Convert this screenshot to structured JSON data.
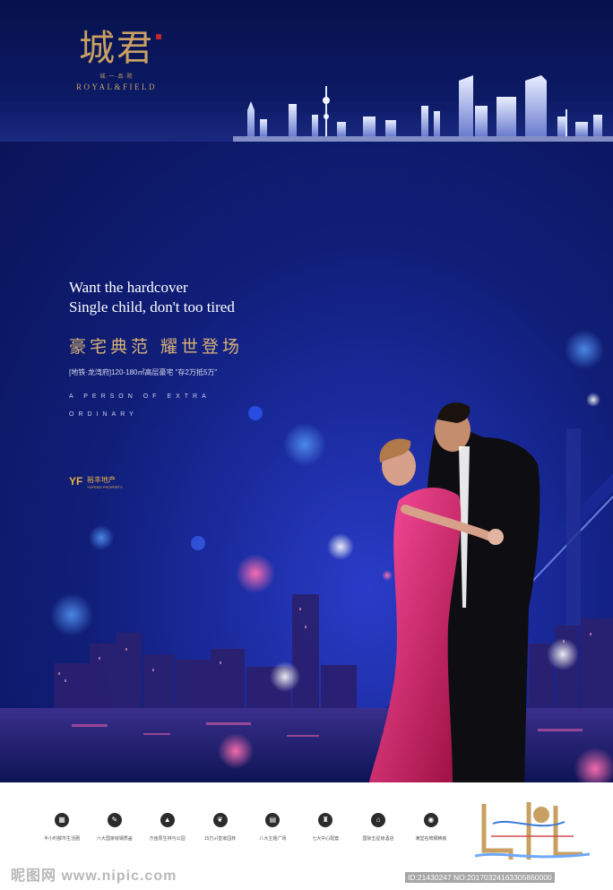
{
  "brand": {
    "logo_cn": "城君",
    "logo_small": "城·一·品·院",
    "logo_en": "ROYAL&FIELD"
  },
  "headline": {
    "line1": "Want the hardcover",
    "line2": "Single child, don't too tired"
  },
  "cn_title": "豪宅典范  耀世登场",
  "subline": "[地铁·龙湾府]120-180㎡高层豪宅 \"存2万抵5万\"",
  "eng_line1": "A PERSON OF EXTRA",
  "eng_line2": "ORDINARY",
  "developer": {
    "mark": "YF",
    "name": "裕丰地产",
    "sub": "YUFENG PROPERTY"
  },
  "features": [
    {
      "icon": "building-icon",
      "glyph": "▦",
      "label": "半小时都市生活圈"
    },
    {
      "icon": "school-icon",
      "glyph": "✎",
      "label": "六大国家级钢质盖"
    },
    {
      "icon": "park-icon",
      "glyph": "▲",
      "label": "万亩原生林与公园"
    },
    {
      "icon": "garden-icon",
      "glyph": "❦",
      "label": "15万㎡皇家园林"
    },
    {
      "icon": "plaza-icon",
      "glyph": "▤",
      "label": "八大主题广场"
    },
    {
      "icon": "bell-icon",
      "glyph": "♜",
      "label": "七大中心配套"
    },
    {
      "icon": "hotel-icon",
      "glyph": "⌂",
      "label": "国际五星级酒店"
    },
    {
      "icon": "brand-icon",
      "glyph": "◉",
      "label": "满堂名牌钢精装"
    }
  ],
  "watermark": {
    "left": "昵图网 www.nipic.com",
    "right": "ID:21430247 NO:20170324163305860000"
  },
  "colors": {
    "gold": "#c8a063",
    "navy": "#0b1450",
    "pink": "#d2246e"
  }
}
